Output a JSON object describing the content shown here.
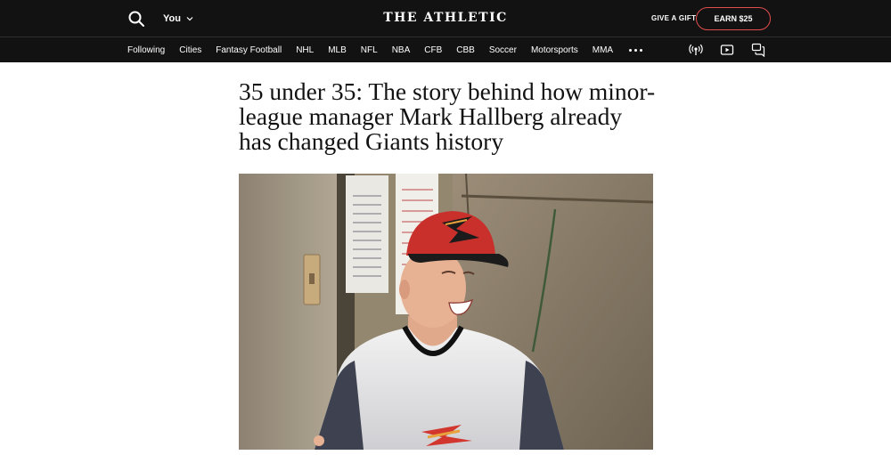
{
  "header": {
    "logo": "THE ATHLETIC",
    "user_label": "You",
    "gift_label": "GIVE A GIFT",
    "earn_label": "EARN $25",
    "accent_color": "#e14d4d",
    "icons": {
      "search": "search-icon",
      "user_chevron": "chevron-down-icon"
    }
  },
  "nav": {
    "items": [
      {
        "label": "Following"
      },
      {
        "label": "Cities"
      },
      {
        "label": "Fantasy Football"
      },
      {
        "label": "NHL"
      },
      {
        "label": "MLB"
      },
      {
        "label": "NFL"
      },
      {
        "label": "NBA"
      },
      {
        "label": "CFB"
      },
      {
        "label": "CBB"
      },
      {
        "label": "Soccer"
      },
      {
        "label": "Motorsports"
      },
      {
        "label": "MMA"
      }
    ],
    "icons": [
      "more-icon",
      "podcast-icon",
      "video-icon",
      "comments-icon"
    ]
  },
  "article": {
    "headline": "35 under 35: The story behind how minor-league manager Mark Hallberg already has changed Giants history"
  }
}
